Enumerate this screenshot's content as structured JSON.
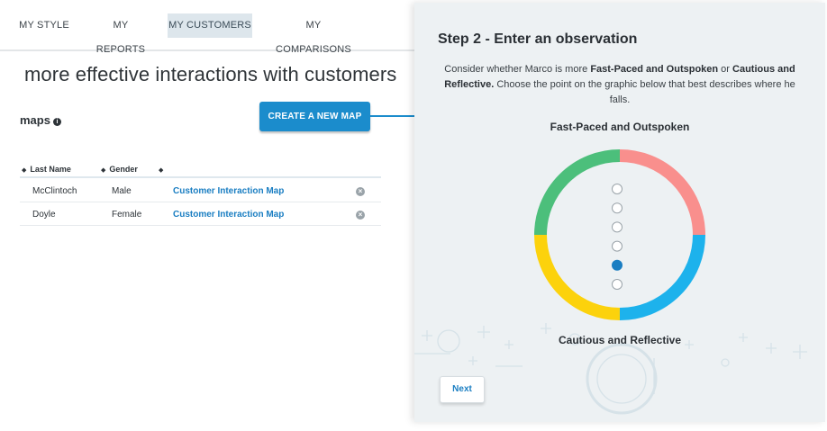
{
  "nav": {
    "items": [
      {
        "label": "MY STYLE"
      },
      {
        "label": "MY REPORTS"
      },
      {
        "label": "MY CUSTOMERS"
      },
      {
        "label": "MY COMPARISONS"
      }
    ],
    "active": "MY CUSTOMERS"
  },
  "headline": "more effective interactions with customers",
  "maps": {
    "title": "maps",
    "info_icon": "info-icon",
    "create_button": "CREATE A NEW MAP"
  },
  "table": {
    "headers": [
      "Last Name",
      "Gender"
    ],
    "rows": [
      {
        "last_name": "McClintoch",
        "gender": "Male",
        "link": "Customer Interaction Map"
      },
      {
        "last_name": "Doyle",
        "gender": "Female",
        "link": "Customer Interaction Map"
      }
    ]
  },
  "panel": {
    "title": "Step 2 - Enter an observation",
    "instruction": {
      "part1": "Consider whether Marco is more ",
      "bold1": "Fast-Paced and Outspoken",
      "part2": " or ",
      "bold2": "Cautious and Reflective.",
      "part3": " Choose the point on the graphic below that best describes where he falls."
    },
    "top_label": "Fast-Paced and Outspoken",
    "bottom_label": "Cautious and Reflective",
    "scale_points": 6,
    "selected_point": 5,
    "ring_colors": {
      "top_left": "#4cbf7b",
      "top_right": "#f98f8d",
      "bottom_right": "#1db2ec",
      "bottom_left": "#fcd20c"
    },
    "accent": "#1a7ec2",
    "next_button": "Next"
  }
}
